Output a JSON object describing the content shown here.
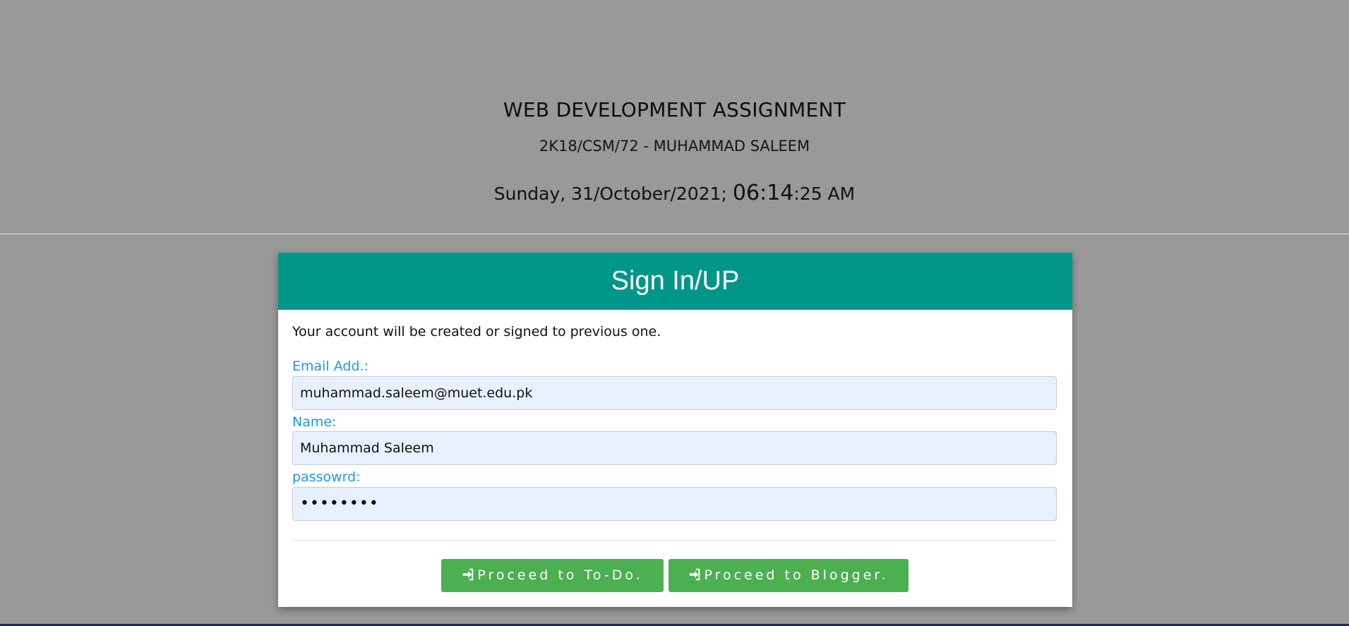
{
  "header": {
    "title": "WEB DEVELOPMENT ASSIGNMENT",
    "student": "2K18/CSM/72 - MUHAMMAD SALEEM",
    "date_prefix": "Sunday, 31/October/2021;",
    "time_hm": "06:14",
    "time_rest": ":25 AM"
  },
  "card": {
    "title": "Sign In/UP",
    "intro": "Your account will be created or signed to previous one.",
    "fields": [
      {
        "label": "Email Add.:",
        "value": "muhammad.saleem@muet.edu.pk"
      },
      {
        "label": "Name:",
        "value": "Muhammad Saleem"
      },
      {
        "label": "passowrd:",
        "value": "••••••••"
      }
    ],
    "buttons": [
      {
        "label": "Proceed to To-Do.",
        "icon": "sign-in-icon"
      },
      {
        "label": "Proceed to Blogger.",
        "icon": "sign-in-icon"
      }
    ]
  },
  "colors": {
    "background": "#999999",
    "card_header": "#009688",
    "label": "#2196f3",
    "field_bg": "#e8f0fe",
    "button": "#4caf50"
  }
}
